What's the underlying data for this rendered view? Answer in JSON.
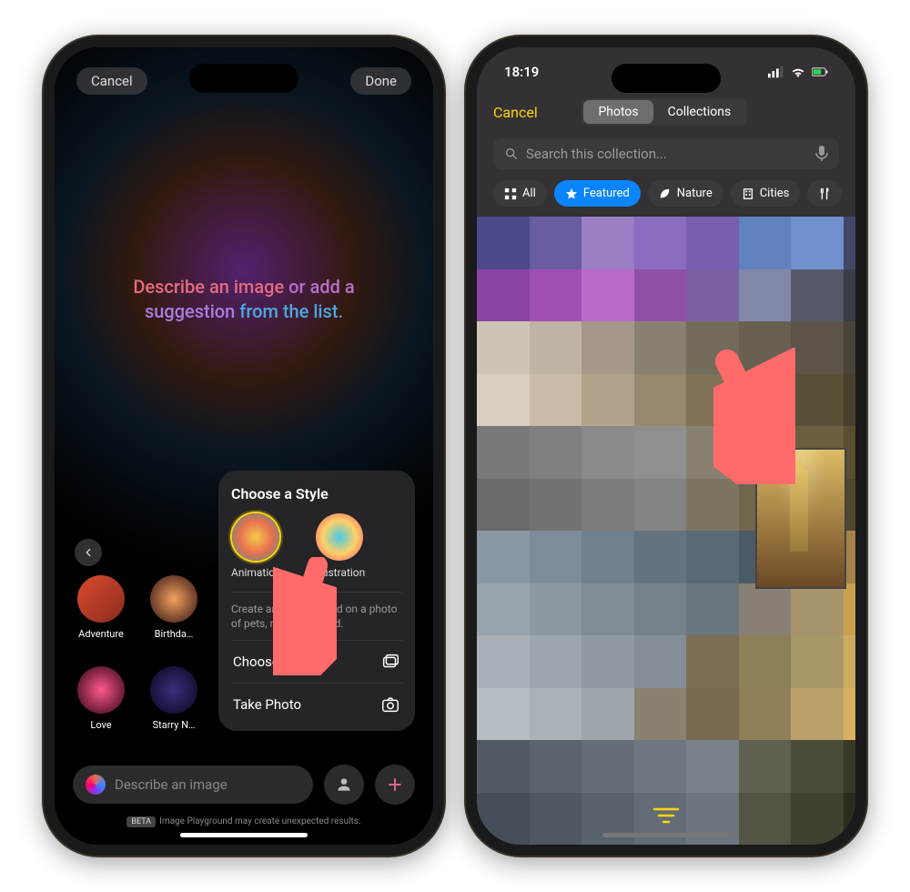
{
  "left": {
    "cancel_label": "Cancel",
    "done_label": "Done",
    "prompt_line1a": "Describe an image",
    "prompt_line1b": " or add a",
    "prompt_line2a": "suggestion",
    "prompt_line2b": " from the list.",
    "suggestions": [
      {
        "label": "Adventure"
      },
      {
        "label": "Birthda…"
      },
      {
        "label": "Love"
      },
      {
        "label": "Starry N…"
      }
    ],
    "panel": {
      "title": "Choose a Style",
      "styles": [
        {
          "label": "Animation",
          "selected": true
        },
        {
          "label": "Illustration",
          "selected": false
        }
      ],
      "hint": "Create an image based on a photo of pets, nature, or food.",
      "choose_photo": "Choose Photo",
      "take_photo": "Take Photo"
    },
    "input_placeholder": "Describe an image",
    "beta_badge": "BETA",
    "beta_text": "Image Playground may create unexpected results."
  },
  "right": {
    "time": "18:19",
    "cancel_label": "Cancel",
    "tabs": {
      "photos": "Photos",
      "collections": "Collections"
    },
    "search_placeholder": "Search this collection...",
    "filters": [
      {
        "icon": "grid",
        "label": "All"
      },
      {
        "icon": "star",
        "label": "Featured",
        "active": true
      },
      {
        "icon": "leaf",
        "label": "Nature"
      },
      {
        "icon": "building",
        "label": "Cities"
      }
    ],
    "grid_colors": [
      "#4a4a88",
      "#6a5ca0",
      "#9a7fc5",
      "#8a6cc0",
      "#7a5fb0",
      "#6080c0",
      "#7090d0",
      "#404868",
      "#8944a5",
      "#a050b5",
      "#b86cc8",
      "#9050a5",
      "#7a5fa5",
      "#8088a8",
      "#545868",
      "#3a3c48",
      "#cfc3b5",
      "#bfb3a3",
      "#a59888",
      "#8a8070",
      "#746c5a",
      "#686050",
      "#5c5448",
      "#4a4438",
      "#d9cfc0",
      "#cabca8",
      "#b0a58c",
      "#95886e",
      "#7f7258",
      "#6b5f46",
      "#5a5038",
      "#48402c",
      "#787878",
      "#808080",
      "#8a8a8a",
      "#909090",
      "#888070",
      "#7a6f55",
      "#6c5f40",
      "#5a4e30",
      "#6a6a6a",
      "#727272",
      "#7c7c7c",
      "#848484",
      "#7c7460",
      "#70664c",
      "#625638",
      "#50462a",
      "#8898a5",
      "#7c8c9a",
      "#6f808e",
      "#637480",
      "#586a78",
      "#4c5a66",
      "#7a5a3a",
      "#a4824a",
      "#98a4ae",
      "#8c98a2",
      "#808c96",
      "#74808a",
      "#6a7680",
      "#888074",
      "#a8946c",
      "#c8a050",
      "#a8b0b8",
      "#9ca6ae",
      "#909aa2",
      "#848e96",
      "#7a6f54",
      "#8c8058",
      "#a89868",
      "#ccac60",
      "#b5bcc2",
      "#aab2b8",
      "#9ea6ac",
      "#8a8270",
      "#766a50",
      "#90805a",
      "#b8a068",
      "#d8b060",
      "#505a64",
      "#5a646e",
      "#646e78",
      "#6e7882",
      "#78828c",
      "#606050",
      "#4a4a3a",
      "#383828",
      "#444e58",
      "#4e5862",
      "#58626c",
      "#626c76",
      "#6c7680",
      "#545444",
      "#404030",
      "#2c2c1e"
    ]
  }
}
